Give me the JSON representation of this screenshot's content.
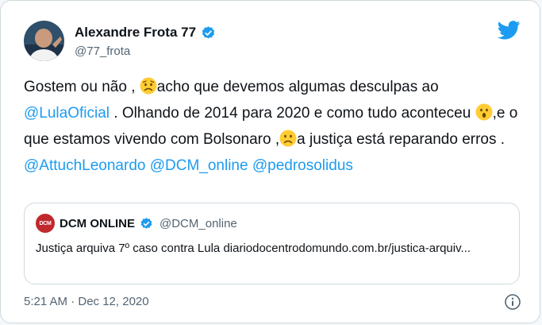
{
  "author": {
    "name": "Alexandre Frota 77",
    "handle": "@77_frota"
  },
  "tweet": {
    "t1": "Gostem ou não , ",
    "t2": "acho que devemos algumas desculpas ao ",
    "mention1": "@LulaOficial",
    "t3": " . Olhando de 2014 para 2020 e como tudo aconteceu ",
    "t4": ",e o que estamos vivendo com Bolsonaro ,",
    "t5": "a justiça está reparando erros . ",
    "mention2": "@AttuchLeonardo",
    "mention3": "@DCM_online",
    "mention4": "@pedrosolidus"
  },
  "quote": {
    "logo_text": "DCM",
    "name": "DCM ONLINE",
    "handle": "@DCM_online",
    "text": "Justiça arquiva 7º caso contra Lula diariodocentrodomundo.com.br/justica-arquiv..."
  },
  "footer": {
    "timestamp": "5:21 AM · Dec 12, 2020"
  },
  "colors": {
    "link": "#1d9bf0",
    "twitter_blue": "#1d9bf0",
    "emoji_yellow": "#ffcc33"
  },
  "icons": [
    "twitter-bird-icon",
    "verified-badge-icon",
    "worried-face-emoji",
    "hushed-face-emoji",
    "frowning-face-emoji",
    "info-icon"
  ]
}
